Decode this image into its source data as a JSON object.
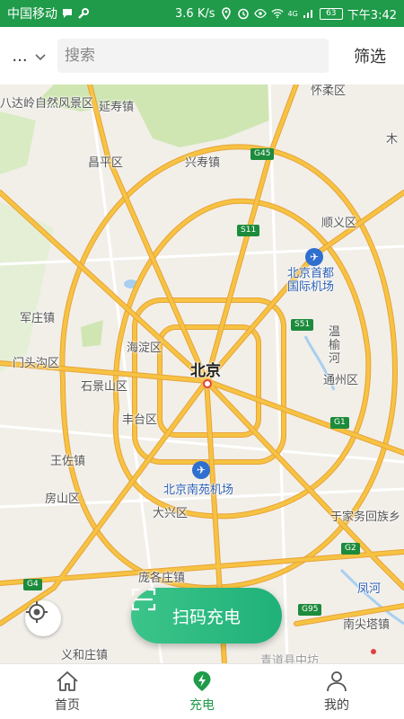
{
  "status_bar": {
    "carrier": "中国移动",
    "speed": "3.6 K/s",
    "network": "4G",
    "battery": "63",
    "time": "下午3:42"
  },
  "header": {
    "city": "...",
    "search_placeholder": "搜索",
    "filter_label": "筛选"
  },
  "map": {
    "center_label": "北京",
    "places": {
      "badaling": "八达岭自然风景区",
      "yanshou": "延寿镇",
      "huairou": "怀柔区",
      "changping": "昌平区",
      "xingshou": "兴寿镇",
      "shunyi": "顺义区",
      "airport": "北京首都国际机场",
      "junzhuang": "军庄镇",
      "haidian": "海淀区",
      "mentougou": "门头沟区",
      "shijingshan": "石景山区",
      "wenyu": "温榆河",
      "tongzhou": "通州区",
      "fengtai": "丰台区",
      "wangzuo": "王佐镇",
      "nanyuan": "北京南苑机场",
      "fangshan": "房山区",
      "daxing": "大兴区",
      "yujiawu": "于家务回族乡",
      "pangge": "庞各庄镇",
      "fenghe": "凤河",
      "yihezhuang": "义和庄镇",
      "nanjian": "南尖塔镇",
      "mu": "木",
      "bottom": "青道县中坊"
    },
    "shields": {
      "g45": "G45",
      "s11": "S11",
      "s51": "S51",
      "g1": "G1",
      "g2": "G2",
      "g4": "G4",
      "g95": "G95"
    },
    "colors": {
      "road": "#f6c342",
      "road_outline": "#e8a33a",
      "minor_road": "#ffffff",
      "park": "#cfe6b3",
      "water": "#a8cff0",
      "brand": "#1f9b4a"
    }
  },
  "scan_button": {
    "label": "扫码充电"
  },
  "nav": {
    "home": "首页",
    "charge": "充电",
    "mine": "我的"
  }
}
